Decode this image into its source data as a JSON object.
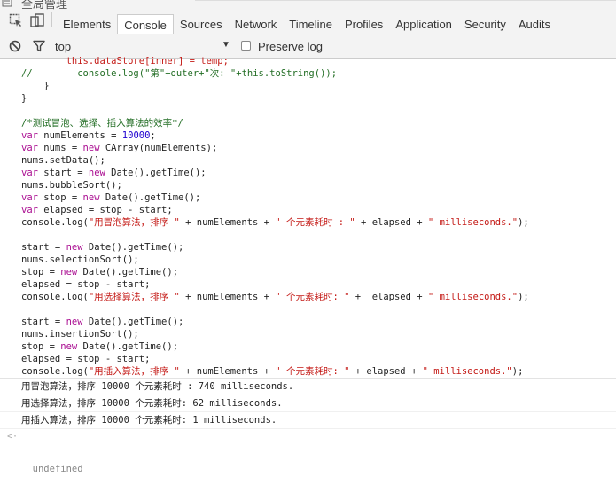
{
  "page_title_partial": "全局管理",
  "devtools": {
    "tabs": [
      {
        "label": "Elements",
        "active": false
      },
      {
        "label": "Console",
        "active": true
      },
      {
        "label": "Sources",
        "active": false
      },
      {
        "label": "Network",
        "active": false
      },
      {
        "label": "Timeline",
        "active": false
      },
      {
        "label": "Profiles",
        "active": false
      },
      {
        "label": "Application",
        "active": false
      },
      {
        "label": "Security",
        "active": false
      },
      {
        "label": "Audits",
        "active": false
      }
    ]
  },
  "filter": {
    "context": "top",
    "preserve_log_label": "Preserve log",
    "preserve_log_checked": false
  },
  "code_lines": [
    [
      {
        "t": "        this.dataStore[inner] = temp;",
        "c": "str"
      }
    ],
    [
      {
        "t": "//        console.log(\"第\"+outer+\"次: \"+this.toString());",
        "c": "cmt"
      }
    ],
    [
      {
        "t": "    }",
        "c": "plain"
      }
    ],
    [
      {
        "t": "}",
        "c": "plain"
      }
    ],
    [
      {
        "t": "",
        "c": "plain"
      }
    ],
    [
      {
        "t": "/*测试冒泡、选择、插入算法的效率*/",
        "c": "cmt"
      }
    ],
    [
      {
        "t": "var",
        "c": "kw"
      },
      {
        "t": " numElements = ",
        "c": "plain"
      },
      {
        "t": "10000",
        "c": "num"
      },
      {
        "t": ";",
        "c": "plain"
      }
    ],
    [
      {
        "t": "var",
        "c": "kw"
      },
      {
        "t": " nums = ",
        "c": "plain"
      },
      {
        "t": "new",
        "c": "kw"
      },
      {
        "t": " CArray(numElements);",
        "c": "plain"
      }
    ],
    [
      {
        "t": "nums.setData();",
        "c": "plain"
      }
    ],
    [
      {
        "t": "var",
        "c": "kw"
      },
      {
        "t": " start = ",
        "c": "plain"
      },
      {
        "t": "new",
        "c": "kw"
      },
      {
        "t": " Date().getTime();",
        "c": "plain"
      }
    ],
    [
      {
        "t": "nums.bubbleSort();",
        "c": "plain"
      }
    ],
    [
      {
        "t": "var",
        "c": "kw"
      },
      {
        "t": " stop = ",
        "c": "plain"
      },
      {
        "t": "new",
        "c": "kw"
      },
      {
        "t": " Date().getTime();",
        "c": "plain"
      }
    ],
    [
      {
        "t": "var",
        "c": "kw"
      },
      {
        "t": " elapsed = stop - start;",
        "c": "plain"
      }
    ],
    [
      {
        "t": "console.log(",
        "c": "plain"
      },
      {
        "t": "\"用冒泡算法，排序 \"",
        "c": "str"
      },
      {
        "t": " + numElements + ",
        "c": "plain"
      },
      {
        "t": "\" 个元素耗时 : \"",
        "c": "str"
      },
      {
        "t": " + elapsed + ",
        "c": "plain"
      },
      {
        "t": "\" milliseconds.\"",
        "c": "str"
      },
      {
        "t": ");",
        "c": "plain"
      }
    ],
    [
      {
        "t": "",
        "c": "plain"
      }
    ],
    [
      {
        "t": "start = ",
        "c": "plain"
      },
      {
        "t": "new",
        "c": "kw"
      },
      {
        "t": " Date().getTime();",
        "c": "plain"
      }
    ],
    [
      {
        "t": "nums.selectionSort();",
        "c": "plain"
      }
    ],
    [
      {
        "t": "stop = ",
        "c": "plain"
      },
      {
        "t": "new",
        "c": "kw"
      },
      {
        "t": " Date().getTime();",
        "c": "plain"
      }
    ],
    [
      {
        "t": "elapsed = stop - start;",
        "c": "plain"
      }
    ],
    [
      {
        "t": "console.log(",
        "c": "plain"
      },
      {
        "t": "\"用选择算法，排序 \"",
        "c": "str"
      },
      {
        "t": " + numElements + ",
        "c": "plain"
      },
      {
        "t": "\" 个元素耗时: \"",
        "c": "str"
      },
      {
        "t": " +  elapsed + ",
        "c": "plain"
      },
      {
        "t": "\" milliseconds.\"",
        "c": "str"
      },
      {
        "t": ");",
        "c": "plain"
      }
    ],
    [
      {
        "t": "",
        "c": "plain"
      }
    ],
    [
      {
        "t": "start = ",
        "c": "plain"
      },
      {
        "t": "new",
        "c": "kw"
      },
      {
        "t": " Date().getTime();",
        "c": "plain"
      }
    ],
    [
      {
        "t": "nums.insertionSort();",
        "c": "plain"
      }
    ],
    [
      {
        "t": "stop = ",
        "c": "plain"
      },
      {
        "t": "new",
        "c": "kw"
      },
      {
        "t": " Date().getTime();",
        "c": "plain"
      }
    ],
    [
      {
        "t": "elapsed = stop - start;",
        "c": "plain"
      }
    ],
    [
      {
        "t": "console.log(",
        "c": "plain"
      },
      {
        "t": "\"用插入算法，排序 \"",
        "c": "str"
      },
      {
        "t": " + numElements + ",
        "c": "plain"
      },
      {
        "t": "\" 个元素耗时: \"",
        "c": "str"
      },
      {
        "t": " + elapsed + ",
        "c": "plain"
      },
      {
        "t": "\" milliseconds.\"",
        "c": "str"
      },
      {
        "t": ");",
        "c": "plain"
      }
    ]
  ],
  "output_lines": [
    "用冒泡算法，排序 10000 个元素耗时 : 740 milliseconds.",
    "用选择算法，排序 10000 个元素耗时: 62 milliseconds.",
    "用插入算法，排序 10000 个元素耗时: 1 milliseconds."
  ],
  "result_text": "undefined",
  "result_arrow": "<·"
}
